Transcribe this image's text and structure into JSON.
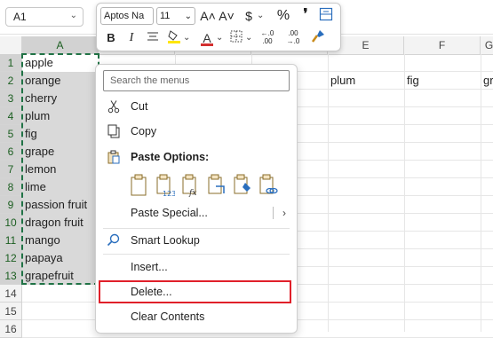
{
  "namebox": {
    "value": "A1"
  },
  "columns": [
    "A",
    "E",
    "F",
    "G"
  ],
  "rows": [
    "1",
    "2",
    "3",
    "4",
    "5",
    "6",
    "7",
    "8",
    "9",
    "10",
    "11",
    "12",
    "13",
    "14",
    "15",
    "16"
  ],
  "colA": [
    "apple",
    "orange",
    "cherry",
    "plum",
    "fig",
    "grape",
    "lemon",
    "lime",
    "passion fruit",
    "dragon fruit",
    "mango",
    "papaya",
    "grapefruit"
  ],
  "row2_right": {
    "E": "plum",
    "F": "fig",
    "G": "gr"
  },
  "minibar": {
    "font": "Aptos Nа",
    "size": "11",
    "grow_label": "A˄",
    "shrink_label": "A˅",
    "currency": "$",
    "percent": "%",
    "comma": "❴",
    "bold": "B",
    "italic": "I",
    "fontcolor": "A"
  },
  "menu": {
    "search_placeholder": "Search the menus",
    "cut": "Cut",
    "copy": "Copy",
    "paste_options": "Paste Options:",
    "paste_special": "Paste Special...",
    "smart_lookup": "Smart Lookup",
    "insert": "Insert...",
    "delete": "Delete...",
    "clear_contents": "Clear Contents"
  },
  "colors": {
    "selection": "#d9d9d9",
    "marquee": "#217346",
    "highlight": "#e0202a",
    "fill_yellow": "#ffe600",
    "font_red": "#d32f2f"
  }
}
